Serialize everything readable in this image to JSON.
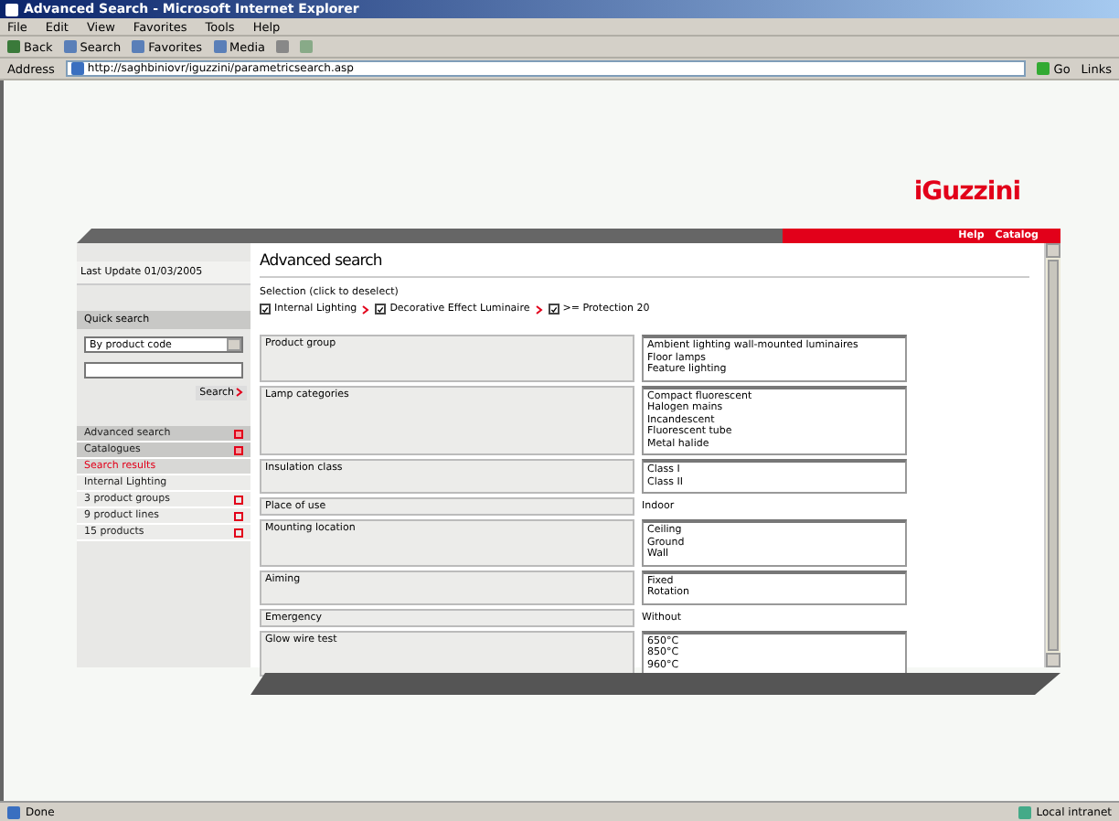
{
  "window": {
    "title": "Advanced Search - Microsoft Internet Explorer",
    "menu": [
      "File",
      "Edit",
      "View",
      "Favorites",
      "Tools",
      "Help"
    ]
  },
  "toolbar": [
    {
      "label": "Back",
      "kind": "text"
    },
    {
      "label": "Search",
      "kind": "text"
    },
    {
      "label": "Favorites",
      "kind": "text"
    },
    {
      "label": "Media",
      "kind": "text"
    }
  ],
  "address": {
    "label": "Address",
    "url": "http://saghbiniovr/iguzzini/parametricsearch.asp",
    "go": "Go",
    "links": "Links"
  },
  "page": {
    "logo": "iGuzzini",
    "top_links": [
      "Help",
      "Catalog"
    ]
  },
  "sidebar": {
    "last_update": "Last Update 01/03/2005",
    "quick_search": {
      "title": "Quick search",
      "select": "By product code",
      "button": "Search"
    },
    "nav": [
      {
        "label": "Advanced search",
        "kind": "section"
      },
      {
        "label": "Catalogues",
        "kind": "section"
      },
      {
        "label": "Search results",
        "kind": "current"
      },
      {
        "label": "Internal Lighting",
        "kind": "plain"
      },
      {
        "label": "3 product groups",
        "kind": "link"
      },
      {
        "label": "9 product lines",
        "kind": "link"
      },
      {
        "label": "15 products",
        "kind": "link"
      }
    ]
  },
  "main": {
    "title": "Advanced search",
    "selection_label": "Selection (click to deselect)",
    "filters": [
      {
        "label": "Internal Lighting",
        "checked": true
      },
      {
        "label": "Decorative Effect Luminaire",
        "checked": true
      },
      {
        "label": ">= Protection 20",
        "checked": true
      }
    ],
    "rows": [
      {
        "label": "Product group",
        "kind": "list",
        "values": [
          "Ambient lighting wall-mounted luminaires",
          "Floor lamps",
          "Feature lighting"
        ]
      },
      {
        "label": "Lamp categories",
        "kind": "list",
        "values": [
          "Compact fluorescent",
          "Halogen mains",
          "Incandescent",
          "Fluorescent tube",
          "Metal halide"
        ]
      },
      {
        "label": "Insulation class",
        "kind": "list",
        "values": [
          "Class I",
          "Class II"
        ]
      },
      {
        "label": "Place of use",
        "kind": "text",
        "values": [
          "Indoor"
        ]
      },
      {
        "label": "Mounting location",
        "kind": "list",
        "values": [
          "Ceiling",
          "Ground",
          "Wall"
        ]
      },
      {
        "label": "Aiming",
        "kind": "list",
        "values": [
          "Fixed",
          "Rotation"
        ]
      },
      {
        "label": "Emergency",
        "kind": "text",
        "values": [
          "Without"
        ]
      },
      {
        "label": "Glow wire test",
        "kind": "list",
        "values": [
          "650°C",
          "850°C",
          "960°C"
        ]
      }
    ]
  },
  "status": {
    "text": "Done",
    "zone": "Local intranet"
  }
}
